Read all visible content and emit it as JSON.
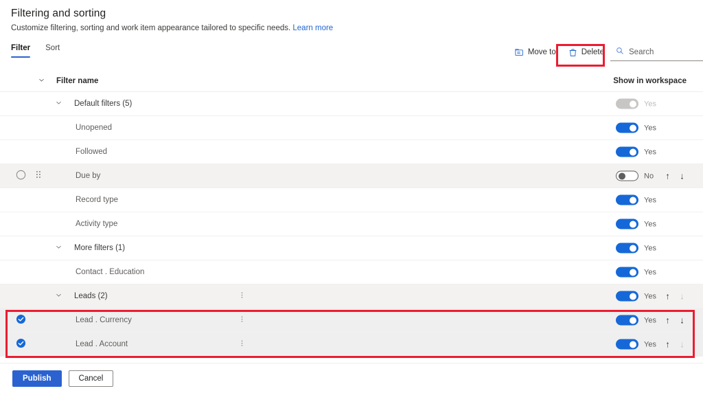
{
  "header": {
    "title": "Filtering and sorting",
    "subtitle": "Customize filtering, sorting and work item appearance tailored to specific needs.",
    "learn_more": "Learn more"
  },
  "tabs": [
    {
      "label": "Filter",
      "active": true
    },
    {
      "label": "Sort",
      "active": false
    }
  ],
  "toolbar": {
    "move_to": "Move to",
    "delete": "Delete",
    "search_placeholder": "Search"
  },
  "table": {
    "col_name": "Filter name",
    "col_show": "Show in workspace",
    "rows": [
      {
        "name": "Default filters (5)",
        "level": "group",
        "toggle": "disabled",
        "toggle_label": "Yes",
        "checked": false,
        "shaded": false,
        "chevron": true,
        "kebab": false,
        "arrows": "none"
      },
      {
        "name": "Unopened",
        "level": "leaf",
        "toggle": "on",
        "toggle_label": "Yes",
        "checked": false,
        "shaded": false,
        "chevron": false,
        "kebab": false,
        "arrows": "none"
      },
      {
        "name": "Followed",
        "level": "leaf",
        "toggle": "on",
        "toggle_label": "Yes",
        "checked": false,
        "shaded": false,
        "chevron": false,
        "kebab": false,
        "arrows": "none"
      },
      {
        "name": "Due by",
        "level": "leaf",
        "toggle": "off",
        "toggle_label": "No",
        "checked": false,
        "shaded": true,
        "chevron": false,
        "kebab": false,
        "arrows": "both",
        "drag": true,
        "circle": true
      },
      {
        "name": "Record type",
        "level": "leaf",
        "toggle": "on",
        "toggle_label": "Yes",
        "checked": false,
        "shaded": false,
        "chevron": false,
        "kebab": false,
        "arrows": "none"
      },
      {
        "name": "Activity type",
        "level": "leaf",
        "toggle": "on",
        "toggle_label": "Yes",
        "checked": false,
        "shaded": false,
        "chevron": false,
        "kebab": false,
        "arrows": "none"
      },
      {
        "name": "More filters (1)",
        "level": "group",
        "toggle": "on",
        "toggle_label": "Yes",
        "checked": false,
        "shaded": false,
        "chevron": true,
        "kebab": false,
        "arrows": "none"
      },
      {
        "name": "Contact . Education",
        "level": "leaf",
        "toggle": "on",
        "toggle_label": "Yes",
        "checked": false,
        "shaded": false,
        "chevron": false,
        "kebab": false,
        "arrows": "none"
      },
      {
        "name": "Leads (2)",
        "level": "group",
        "toggle": "on",
        "toggle_label": "Yes",
        "checked": false,
        "shaded": true,
        "chevron": true,
        "kebab": true,
        "arrows": "up"
      },
      {
        "name": "Lead . Currency",
        "level": "leaf",
        "toggle": "on",
        "toggle_label": "Yes",
        "checked": true,
        "shaded": true,
        "chevron": false,
        "kebab": true,
        "arrows": "both"
      },
      {
        "name": "Lead . Account",
        "level": "leaf",
        "toggle": "on",
        "toggle_label": "Yes",
        "checked": true,
        "shaded": true,
        "chevron": false,
        "kebab": true,
        "arrows": "up"
      }
    ]
  },
  "footer": {
    "publish": "Publish",
    "cancel": "Cancel"
  },
  "colors": {
    "accent": "#2b62d0",
    "toggle_on": "#1668d8",
    "annotation": "#ec1c30",
    "link": "#2266cc"
  }
}
